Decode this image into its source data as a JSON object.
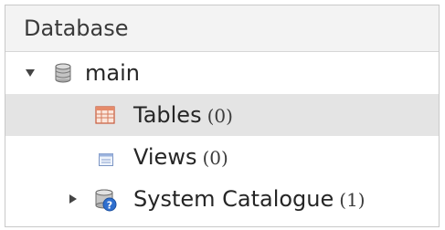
{
  "panel": {
    "header": "Database"
  },
  "tree": {
    "main": {
      "label": "main",
      "icon": "database-icon",
      "expanded": true
    },
    "tables": {
      "label": "Tables",
      "count": "(0)",
      "icon": "table-icon"
    },
    "views": {
      "label": "Views",
      "count": "(0)",
      "icon": "view-icon"
    },
    "system_catalogue": {
      "label": "System Catalogue",
      "count": "(1)",
      "icon": "system-catalogue-icon",
      "expanded": false
    }
  },
  "colors": {
    "header_bg": "#f3f3f3",
    "selected_row_bg": "#e4e4e4",
    "border": "#c9c9c9"
  }
}
